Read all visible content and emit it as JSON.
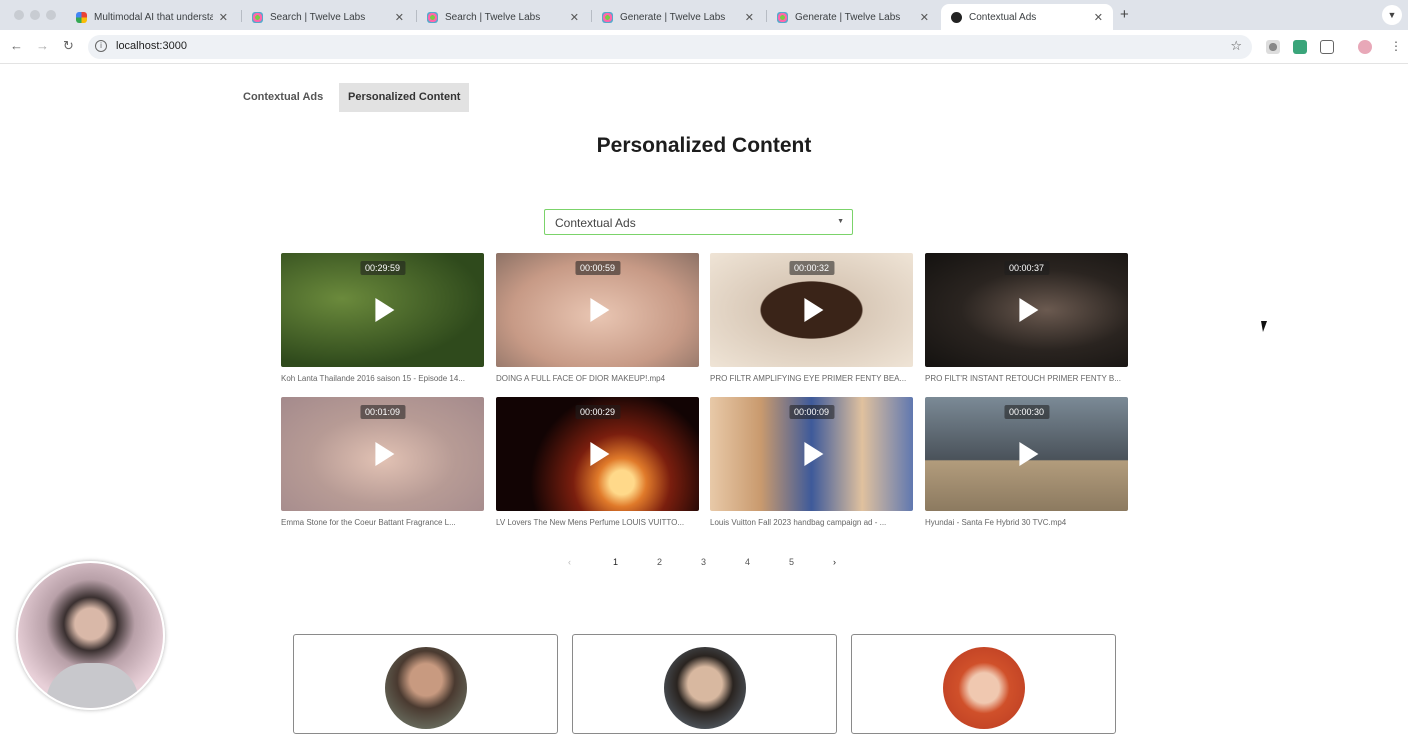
{
  "browser": {
    "tabs": [
      {
        "title": "Multimodal AI that understan"
      },
      {
        "title": "Search | Twelve Labs"
      },
      {
        "title": "Search | Twelve Labs"
      },
      {
        "title": "Generate | Twelve Labs"
      },
      {
        "title": "Generate | Twelve Labs"
      },
      {
        "title": "Contextual Ads",
        "active": true
      }
    ],
    "new_tab": "+",
    "url": "localhost:3000"
  },
  "nav": {
    "tabs": [
      {
        "label": "Contextual Ads"
      },
      {
        "label": "Personalized Content",
        "active": true
      }
    ]
  },
  "main": {
    "heading": "Personalized Content",
    "select": {
      "value": "Contextual Ads"
    },
    "videos": [
      {
        "duration": "00:29:59",
        "title": "Koh Lanta Thailande 2016 saison 15 - Episode 14..."
      },
      {
        "duration": "00:00:59",
        "title": "DOING A FULL FACE OF DIOR MAKEUP!.mp4"
      },
      {
        "duration": "00:00:32",
        "title": "PRO FILTR AMPLIFYING EYE PRIMER FENTY BEA..."
      },
      {
        "duration": "00:00:37",
        "title": "PRO FILT'R INSTANT RETOUCH PRIMER FENTY B..."
      },
      {
        "duration": "00:01:09",
        "title": "Emma Stone for the Coeur Battant Fragrance L..."
      },
      {
        "duration": "00:00:29",
        "title": "LV Lovers The New Mens Perfume LOUIS VUITTO..."
      },
      {
        "duration": "00:00:09",
        "title": "Louis Vuitton Fall 2023 handbag campaign ad - ..."
      },
      {
        "duration": "00:00:30",
        "title": "Hyundai - Santa Fe Hybrid 30 TVC.mp4"
      }
    ],
    "pagination": {
      "prev": "‹",
      "pages": [
        "1",
        "2",
        "3",
        "4",
        "5"
      ],
      "next": "›",
      "current": "1"
    }
  },
  "colors": {
    "accent": "#7bd36a",
    "active_tab_bg": "#e2e2e2"
  }
}
